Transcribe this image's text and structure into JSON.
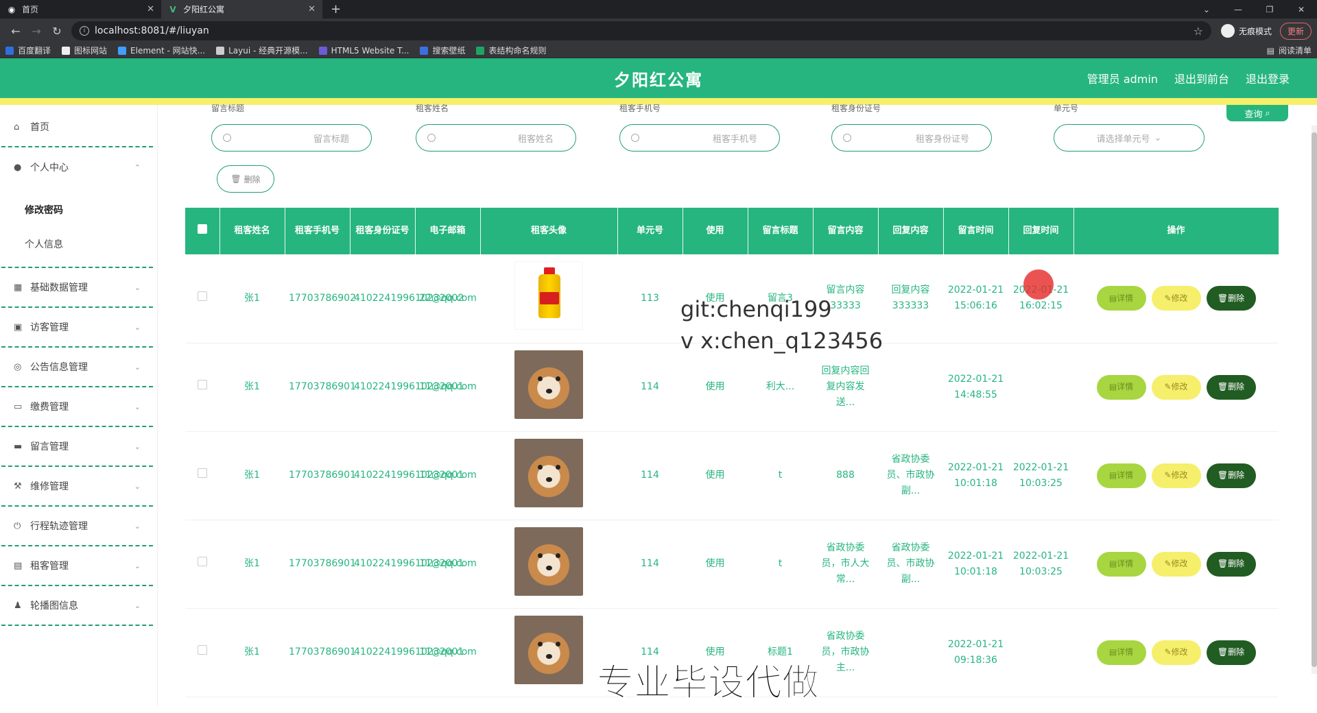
{
  "browser": {
    "tabs": [
      {
        "title": "首页",
        "active": false
      },
      {
        "title": "夕阳红公寓",
        "active": true
      }
    ],
    "url": "localhost:8081/#/liuyan",
    "incognito_label": "无痕模式",
    "update_label": "更新",
    "bookmarks": [
      "百度翻译",
      "图标网站",
      "Element - 网站快...",
      "Layui - 经典开源模...",
      "HTML5 Website T...",
      "搜索壁纸",
      "表结构命名规则"
    ],
    "reading_list": "阅读清单"
  },
  "header": {
    "title": "夕阳红公寓",
    "admin": "管理员 admin",
    "to_front": "退出到前台",
    "logout": "退出登录"
  },
  "sidebar": {
    "items": [
      {
        "label": "首页",
        "icon": "home-icon"
      },
      {
        "label": "个人中心",
        "icon": "user-icon",
        "expanded": true
      },
      {
        "label": "基础数据管理",
        "icon": "grid-icon"
      },
      {
        "label": "访客管理",
        "icon": "building-icon"
      },
      {
        "label": "公告信息管理",
        "icon": "compass-icon"
      },
      {
        "label": "缴费管理",
        "icon": "chat-icon"
      },
      {
        "label": "留言管理",
        "icon": "bag-icon"
      },
      {
        "label": "维修管理",
        "icon": "tool-icon"
      },
      {
        "label": "行程轨迹管理",
        "icon": "power-icon"
      },
      {
        "label": "租客管理",
        "icon": "clipboard-icon"
      },
      {
        "label": "轮播图信息",
        "icon": "stamp-icon"
      }
    ],
    "sub_items": [
      "修改密码",
      "个人信息"
    ]
  },
  "search": {
    "fields": [
      {
        "label": "留言标题",
        "placeholder": "留言标题"
      },
      {
        "label": "租客姓名",
        "placeholder": "租客姓名"
      },
      {
        "label": "租客手机号",
        "placeholder": "租客手机号"
      },
      {
        "label": "租客身份证号",
        "placeholder": "租客身份证号"
      },
      {
        "label": "单元号",
        "placeholder": "请选择单元号"
      }
    ],
    "query_label": "查询",
    "delete_label": "删除"
  },
  "table": {
    "headers": [
      "租客姓名",
      "租客手机号",
      "租客身份证号",
      "电子邮箱",
      "租客头像",
      "单元号",
      "使用",
      "留言标题",
      "留言内容",
      "回复内容",
      "留言时间",
      "回复时间",
      "操作"
    ],
    "rows": [
      {
        "name": "张1",
        "phone": "17703786902",
        "idcard": "410224199610232002",
        "email": "22@qq.com",
        "avatar": "oil-bottle",
        "unit": "113",
        "use": "使用",
        "title": "留言3",
        "content": "留言内容33333",
        "reply": "回复内容333333",
        "msg_time": "2022-01-21 15:06:16",
        "reply_time": "2022-01-21 16:02:15"
      },
      {
        "name": "张1",
        "phone": "17703786901",
        "idcard": "410224199610232001",
        "email": "11@qq.com",
        "avatar": "shiba-dog",
        "unit": "114",
        "use": "使用",
        "title": "利大...",
        "content": "回复内容回复内容发送...",
        "reply": "",
        "msg_time": "2022-01-21 14:48:55",
        "reply_time": ""
      },
      {
        "name": "张1",
        "phone": "17703786901",
        "idcard": "410224199610232001",
        "email": "11@qq.com",
        "avatar": "shiba-dog",
        "unit": "114",
        "use": "使用",
        "title": "t",
        "content": "888",
        "reply": "省政协委员、市政协副...",
        "msg_time": "2022-01-21 10:01:18",
        "reply_time": "2022-01-21 10:03:25"
      },
      {
        "name": "张1",
        "phone": "17703786901",
        "idcard": "410224199610232001",
        "email": "11@qq.com",
        "avatar": "shiba-dog",
        "unit": "114",
        "use": "使用",
        "title": "t",
        "content": "省政协委员，市人大常...",
        "reply": "省政协委员、市政协副...",
        "msg_time": "2022-01-21 10:01:18",
        "reply_time": "2022-01-21 10:03:25"
      },
      {
        "name": "张1",
        "phone": "17703786901",
        "idcard": "410224199610232001",
        "email": "11@qq.com",
        "avatar": "shiba-dog",
        "unit": "114",
        "use": "使用",
        "title": "标题1",
        "content": "省政协委员，市政协主...",
        "reply": "",
        "msg_time": "2022-01-21 09:18:36",
        "reply_time": ""
      }
    ],
    "ops": {
      "detail": "详情",
      "edit": "修改",
      "remove": "删除"
    }
  },
  "overlay": {
    "line1": "git:chenqi199",
    "line2": "v x:chen_q123456",
    "banner": "专业毕设代做"
  },
  "colors": {
    "primary": "#26b57f",
    "accent_yellow": "#f5ef6b",
    "dark_green": "#215c22",
    "lime": "#a7d641"
  }
}
